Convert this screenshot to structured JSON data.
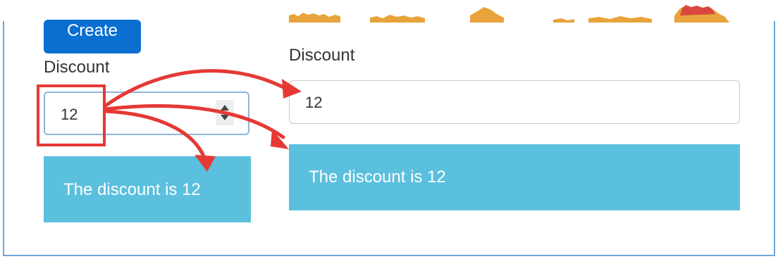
{
  "left_panel": {
    "create_button": "Create",
    "discount_label": "Discount",
    "discount_value": "12",
    "message": "The discount is 12"
  },
  "right_panel": {
    "discount_label": "Discount",
    "discount_value": "12",
    "message": "The discount is 12"
  },
  "colors": {
    "primary_button": "#0a6fd1",
    "info_alert": "#5bc0de",
    "annotation_red": "#e53935"
  },
  "icons": {
    "stepper": "spinner-arrows-icon",
    "annotation": "curved-arrow-icon"
  }
}
